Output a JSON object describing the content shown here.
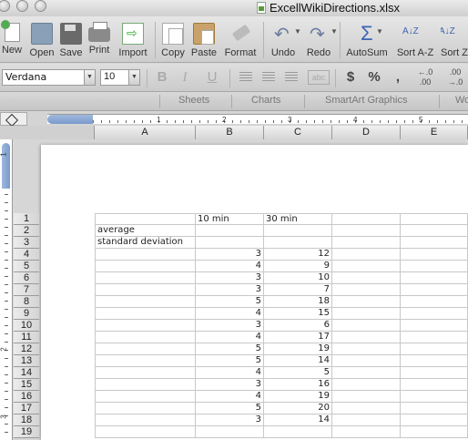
{
  "window": {
    "title": "ExcellWikiDirections.xlsx"
  },
  "toolbar": {
    "items": [
      {
        "label": "New",
        "icon": "new-workbook-icon"
      },
      {
        "label": "Open",
        "icon": "open-folder-icon"
      },
      {
        "label": "Save",
        "icon": "save-disk-icon"
      },
      {
        "label": "Print",
        "icon": "printer-icon"
      },
      {
        "label": "Import",
        "icon": "import-icon"
      },
      {
        "label": "Copy",
        "icon": "copy-icon"
      },
      {
        "label": "Paste",
        "icon": "paste-clipboard-icon"
      },
      {
        "label": "Format",
        "icon": "format-brush-icon"
      },
      {
        "label": "Undo",
        "icon": "undo-arrow-icon"
      },
      {
        "label": "Redo",
        "icon": "redo-arrow-icon"
      },
      {
        "label": "AutoSum",
        "icon": "sigma-icon"
      },
      {
        "label": "Sort A-Z",
        "icon": "sort-az-icon"
      },
      {
        "label": "Sort Z",
        "icon": "sort-za-icon"
      }
    ]
  },
  "format_bar": {
    "font_name": "Verdana",
    "font_size": "10",
    "bold": "B",
    "italic": "I",
    "underline": "U",
    "currency": "$",
    "percent": "%",
    "comma": ",",
    "dec_decrease": "←.0 .00",
    "dec_increase": ".00 →.0",
    "wrap_abc": "abc"
  },
  "ribbon": {
    "tabs": [
      "Sheets",
      "Charts",
      "SmartArt Graphics",
      "Wo"
    ]
  },
  "ruler": {
    "marks": [
      "1",
      "2",
      "3",
      "4",
      "5"
    ],
    "vmarks": [
      "1",
      "2",
      "3"
    ]
  },
  "columns": [
    "A",
    "B",
    "C",
    "D",
    "E"
  ],
  "sheet": {
    "rows": [
      {
        "n": "1",
        "a": "",
        "b": "10 min",
        "c": "30 min"
      },
      {
        "n": "2",
        "a": "average",
        "b": "",
        "c": ""
      },
      {
        "n": "3",
        "a": "standard deviation",
        "b": "",
        "c": ""
      },
      {
        "n": "4",
        "a": "",
        "b": "3",
        "c": "12"
      },
      {
        "n": "5",
        "a": "",
        "b": "4",
        "c": "9"
      },
      {
        "n": "6",
        "a": "",
        "b": "3",
        "c": "10"
      },
      {
        "n": "7",
        "a": "",
        "b": "3",
        "c": "7"
      },
      {
        "n": "8",
        "a": "",
        "b": "5",
        "c": "18"
      },
      {
        "n": "9",
        "a": "",
        "b": "4",
        "c": "15"
      },
      {
        "n": "10",
        "a": "",
        "b": "3",
        "c": "6"
      },
      {
        "n": "11",
        "a": "",
        "b": "4",
        "c": "17"
      },
      {
        "n": "12",
        "a": "",
        "b": "5",
        "c": "19"
      },
      {
        "n": "13",
        "a": "",
        "b": "5",
        "c": "14"
      },
      {
        "n": "14",
        "a": "",
        "b": "4",
        "c": "5"
      },
      {
        "n": "15",
        "a": "",
        "b": "3",
        "c": "16"
      },
      {
        "n": "16",
        "a": "",
        "b": "4",
        "c": "19"
      },
      {
        "n": "17",
        "a": "",
        "b": "5",
        "c": "20"
      },
      {
        "n": "18",
        "a": "",
        "b": "3",
        "c": "14"
      },
      {
        "n": "19",
        "a": "",
        "b": "",
        "c": ""
      }
    ]
  }
}
